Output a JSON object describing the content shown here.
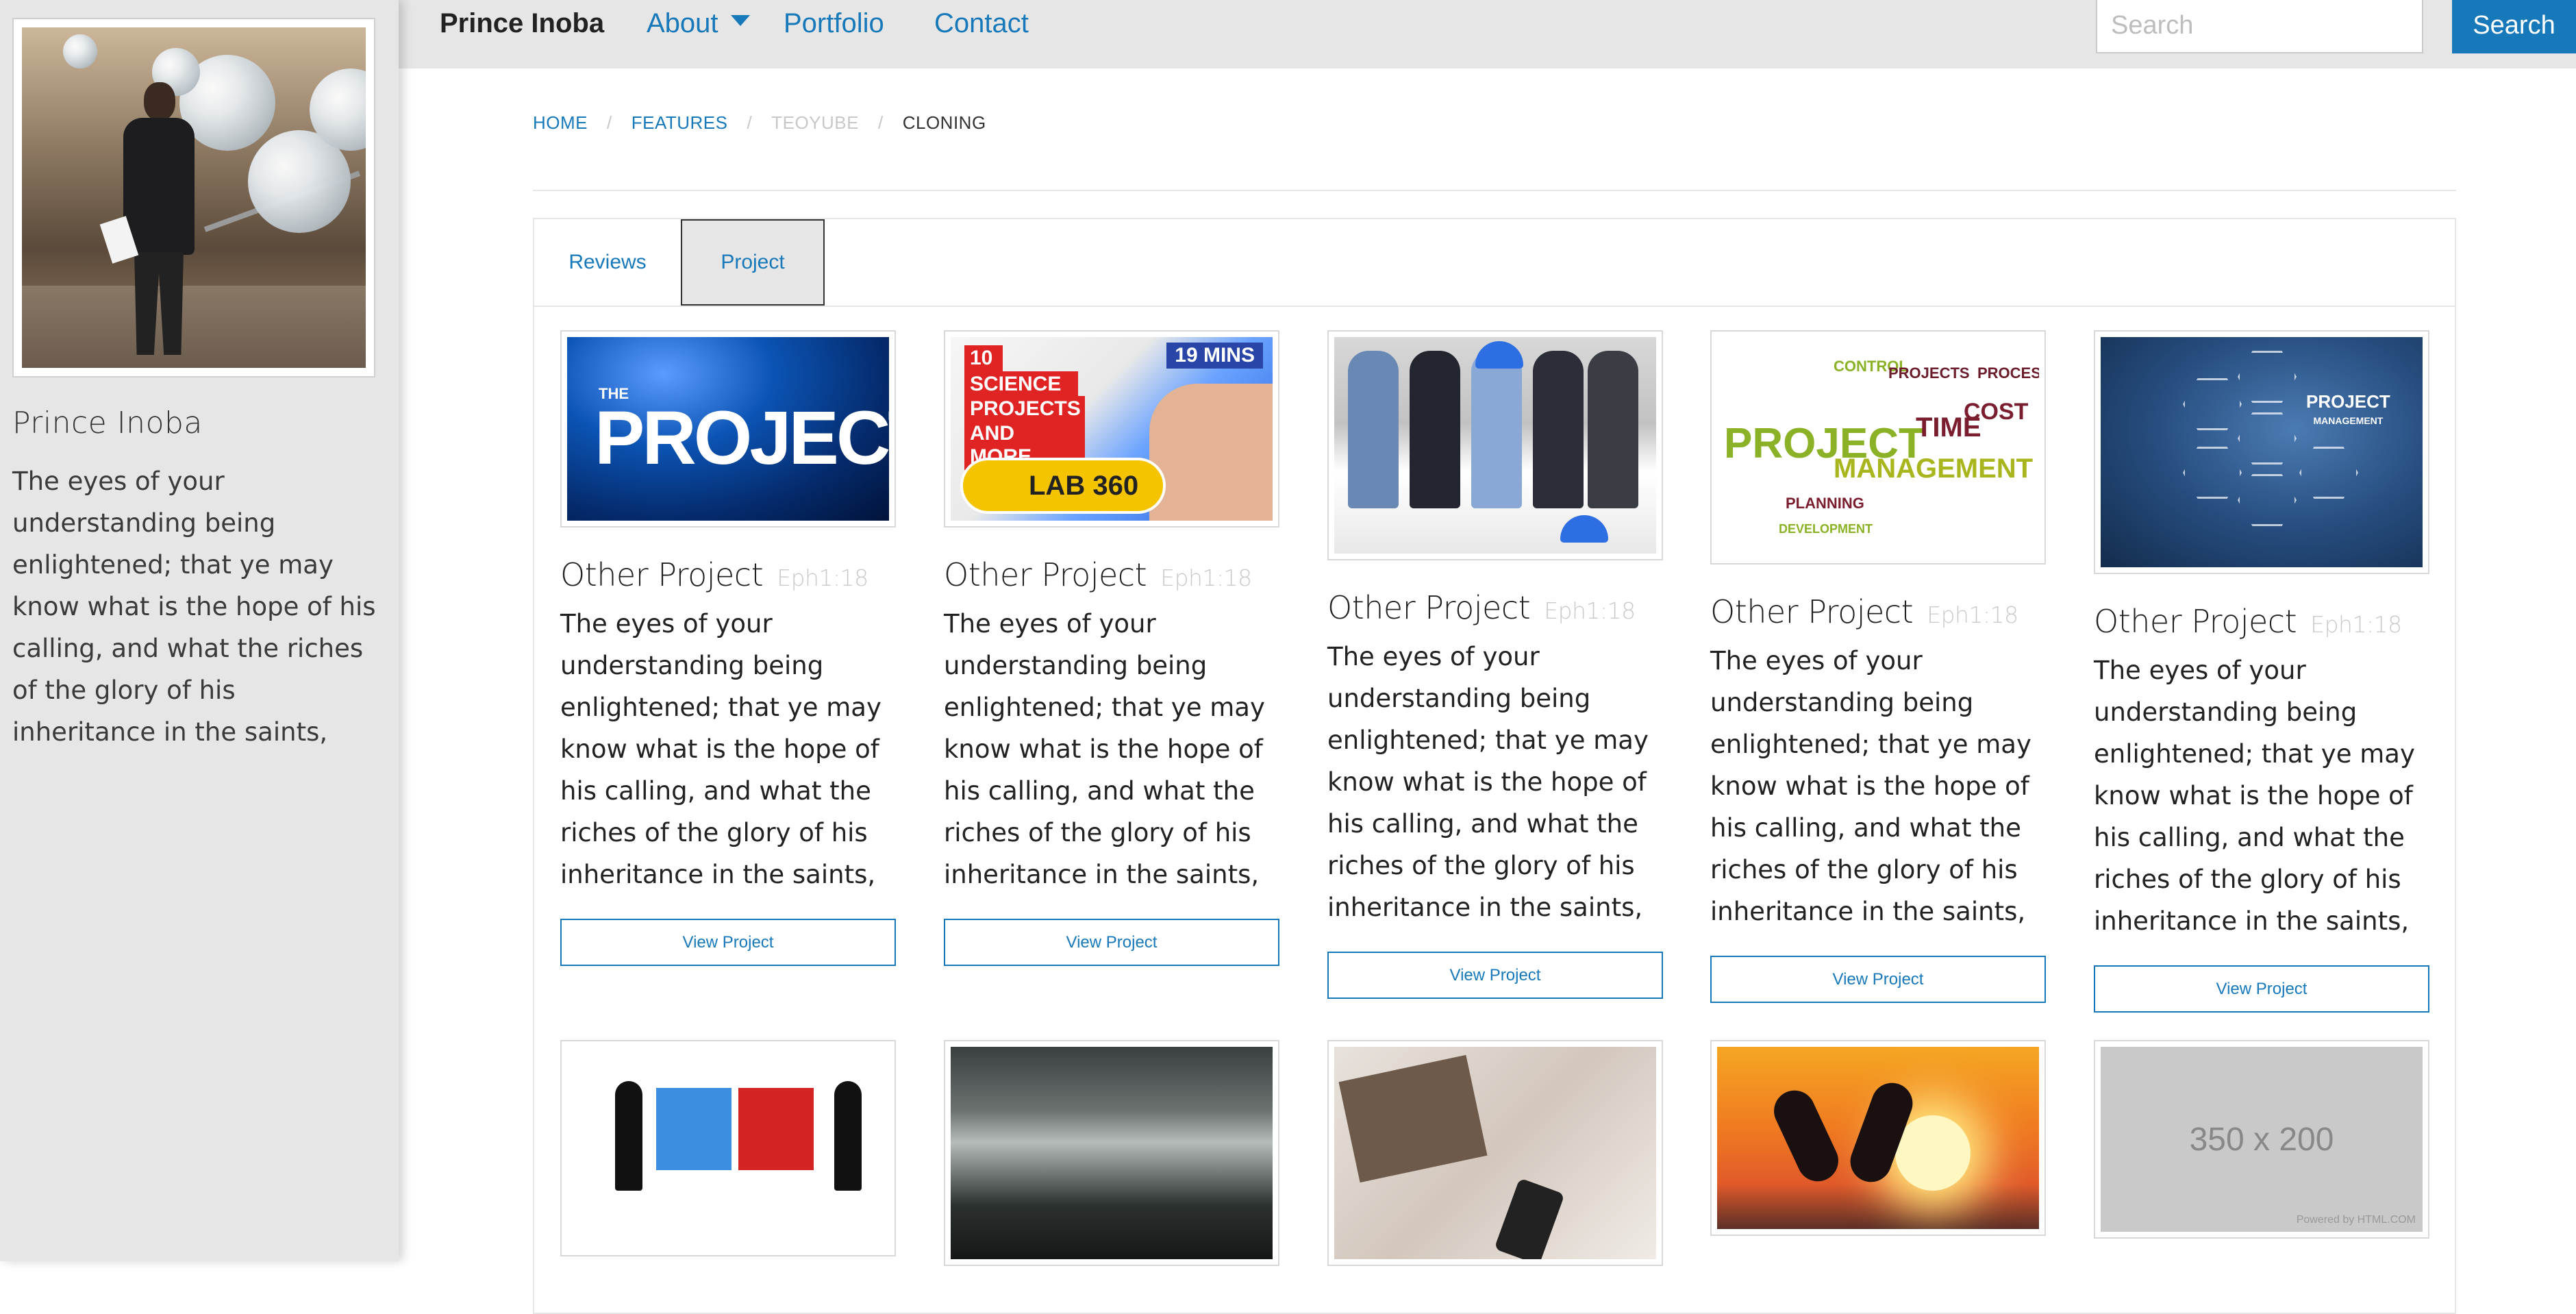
{
  "sidebar": {
    "name": "Prince Inoba",
    "bio": "The eyes of your understanding being enlightened; that ye may know what is the hope of his calling, and what the riches of the glory of his inheritance in the saints,"
  },
  "topbar": {
    "brand": "Prince Inoba",
    "nav": [
      "About",
      "Portfolio",
      "Contact"
    ],
    "search_placeholder": "Search",
    "search_button": "Search"
  },
  "breadcrumb": [
    "HOME",
    "FEATURES",
    "TEOYUBE",
    "CLONING"
  ],
  "tabs": [
    "Reviews",
    "Project"
  ],
  "thumb_text": {
    "project": "PROJECT",
    "the": "THE",
    "science_red": [
      "10",
      "SCIENCE",
      "PROJECTS",
      "AND MORE"
    ],
    "mins": "19 MINS",
    "lab": "LAB 360",
    "wc_project": "PROJECT",
    "wc_management": "MANAGEMENT",
    "wc_time": "TIME",
    "wc_cost": "COST",
    "wc_small": [
      "CONTROL",
      "PROJECTS",
      "PROCESS",
      "PLANNING",
      "DEVELOPMENT"
    ],
    "pm_label": "PROJECT",
    "pm_sub": "MANAGEMENT",
    "placeholder": "350 x 200",
    "placeholder_by": "Powered by HTML.COM"
  },
  "cards": [
    {
      "title": "Other Project",
      "ref": "Eph1:18",
      "text": "The eyes of your understanding being enlightened; that ye may know what is the hope of his calling, and what the riches of the glory of his inheritance in the saints,",
      "button": "View Project"
    },
    {
      "title": "Other Project",
      "ref": "Eph1:18",
      "text": "The eyes of your understanding being enlightened; that ye may know what is the hope of his calling, and what the riches of the glory of his inheritance in the saints,",
      "button": "View Project"
    },
    {
      "title": "Other Project",
      "ref": "Eph1:18",
      "text": "The eyes of your understanding being enlightened; that ye may know what is the hope of his calling, and what the riches of the glory of his inheritance in the saints,",
      "button": "View Project"
    },
    {
      "title": "Other Project",
      "ref": "Eph1:18",
      "text": "The eyes of your understanding being enlightened; that ye may know what is the hope of his calling, and what the riches of the glory of his inheritance in the saints,",
      "button": "View Project"
    },
    {
      "title": "Other Project",
      "ref": "Eph1:18",
      "text": "The eyes of your understanding being enlightened; that ye may know what is the hope of his calling, and what the riches of the glory of his inheritance in the saints,",
      "button": "View Project"
    }
  ],
  "colors": {
    "accent": "#1779ba",
    "topbar_bg": "#e6e6e6",
    "sidebar_bg": "#e6e6e6",
    "muted": "#cacaca"
  }
}
